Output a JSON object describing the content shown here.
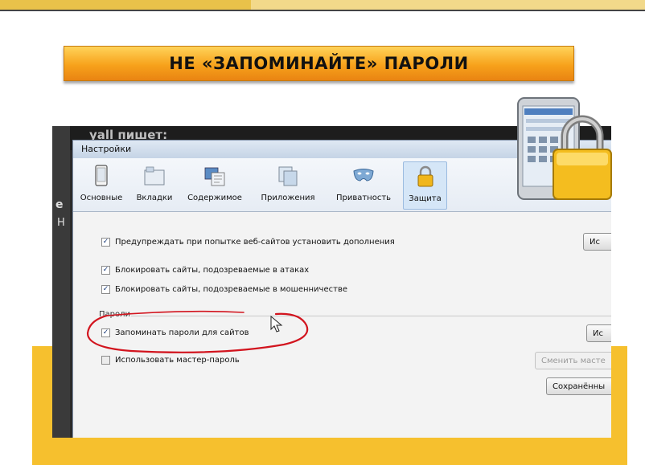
{
  "slide": {
    "title": "НЕ «ЗАПОМИНАЙТЕ» ПАРОЛИ"
  },
  "background_window": {
    "header_text": "yall пишет:",
    "left_letter_1": "е",
    "left_letter_2": "Н"
  },
  "dialog": {
    "title": "Настройки",
    "tabs": [
      {
        "label": "Основные",
        "icon": "phone-icon"
      },
      {
        "label": "Вкладки",
        "icon": "tabs-icon"
      },
      {
        "label": "Содержимое",
        "icon": "content-icon"
      },
      {
        "label": "Приложения",
        "icon": "applications-icon"
      },
      {
        "label": "Приватность",
        "icon": "mask-icon"
      },
      {
        "label": "Защита",
        "icon": "padlock-icon",
        "selected": true
      }
    ],
    "checkboxes": {
      "warn_addons": {
        "label": "Предупреждать при попытке веб-сайтов установить дополнения",
        "checked": true
      },
      "block_attack": {
        "label": "Блокировать сайты, подозреваемые в атаках",
        "checked": true
      },
      "block_fraud": {
        "label": "Блокировать сайты, подозреваемые в мошенничестве",
        "checked": true
      },
      "remember_passwords": {
        "label": "Запоминать пароли для сайтов",
        "checked": true
      },
      "master_password": {
        "label": "Использовать мастер-пароль",
        "checked": false
      }
    },
    "passwords_group_label": "Пароли",
    "buttons": {
      "exceptions_1": "Ис",
      "exceptions_2": "Ис",
      "change_master": "Сменить масте",
      "saved_passwords": "Сохранённы"
    }
  },
  "colors": {
    "banner_top": "#ffd35a",
    "banner_bottom": "#e98412",
    "accent_yellow": "#f6c02e",
    "annotation_red": "#d2141e"
  }
}
